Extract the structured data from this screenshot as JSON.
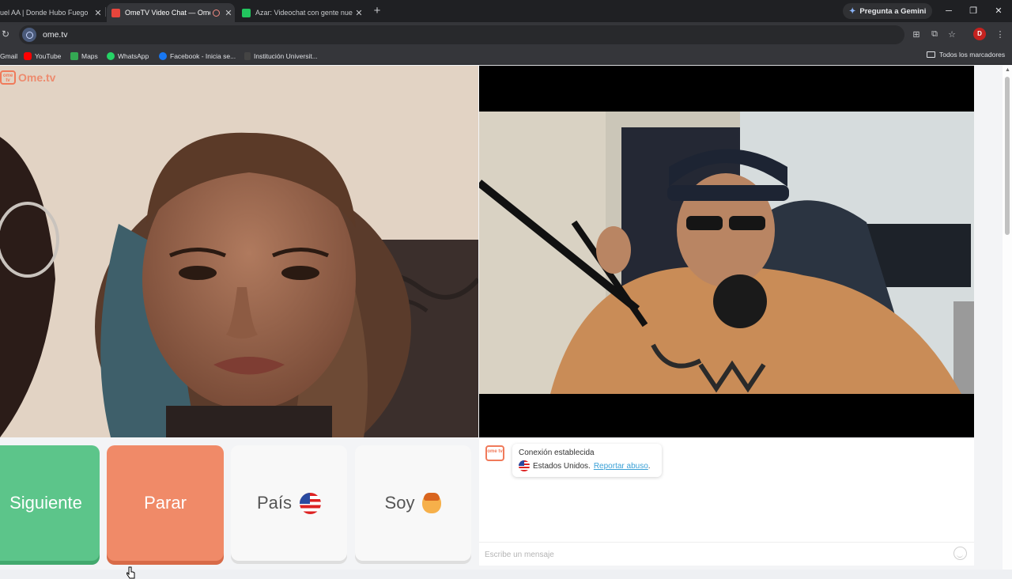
{
  "browser": {
    "tabs": [
      {
        "title": "uel AA | Donde Hubo Fuego",
        "favicon_color": "#ff0000",
        "active": false
      },
      {
        "title": "OmeTV Video Chat — Ome",
        "favicon_color": "#e8453c",
        "active": true
      },
      {
        "title": "Azar: Videochat con gente nue",
        "favicon_color": "#22c55e",
        "active": false
      }
    ],
    "gemini_label": "Pregunta a Gemini",
    "url": "ome.tv",
    "profile_initial": "D",
    "bookmarks": [
      {
        "label": "Gmail",
        "color": "#ea4335"
      },
      {
        "label": "YouTube",
        "color": "#ff0000"
      },
      {
        "label": "Maps",
        "color": "#34a853"
      },
      {
        "label": "WhatsApp",
        "color": "#25d366"
      },
      {
        "label": "Facebook - Inicia se...",
        "color": "#1877f2"
      },
      {
        "label": "Institución Universit...",
        "color": "#444444"
      }
    ],
    "all_bookmarks_label": "Todos los marcadores"
  },
  "app": {
    "logo_text": "Ome.tv",
    "logo_badge": "ome tv",
    "buttons": {
      "next": "Siguiente",
      "stop": "Parar",
      "country": "País",
      "gender": "Soy"
    },
    "chat": {
      "system_title": "Conexión establecida",
      "country": "Estados Unidos.",
      "report_link": "Reportar abuso",
      "input_placeholder": "Escribe un mensaje"
    },
    "colors": {
      "next": "#5cc58a",
      "stop": "#f08a68",
      "brand": "#f07a5a",
      "link": "#3aa0d6"
    }
  }
}
